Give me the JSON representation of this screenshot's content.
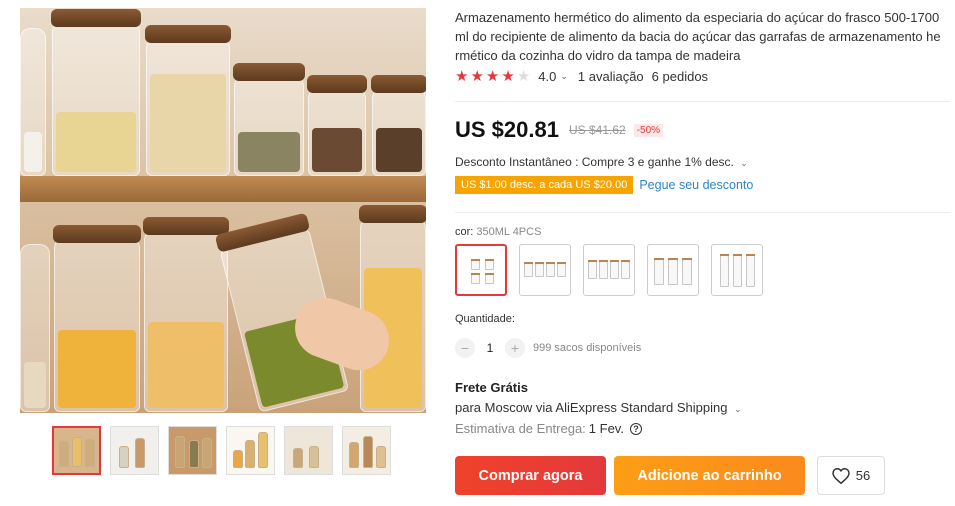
{
  "product": {
    "title": "Armazenamento hermético do alimento da especiaria do açúcar do frasco 500-1700 ml do recipiente de alimento da bacia do açúcar das garrafas de armazenamento he rmético da cozinha do vidro da tampa de madeira",
    "rating": "4.0",
    "stars_filled": 4,
    "stars_total": 5,
    "reviews": "1 avaliação",
    "orders": "6 pedidos"
  },
  "price": {
    "current": "US $20.81",
    "original": "US $41.62",
    "discount": "-50%"
  },
  "promo": {
    "instant": "Desconto Instantâneo : Compre 3 e ganhe 1% desc.",
    "coupon": "US $1.00 desc. a cada US $20.00",
    "coupon_link": "Pegue seu desconto"
  },
  "variant": {
    "label": "cor:",
    "selected": "350ML 4PCS"
  },
  "quantity": {
    "label": "Quantidade:",
    "value": "1",
    "minus": "−",
    "plus": "+",
    "available": "999 sacos disponíveis"
  },
  "shipping": {
    "title": "Frete Grátis",
    "line": "para Moscow via AliExpress Standard Shipping",
    "delivery_label": "Estimativa de Entrega:",
    "delivery_value": "1 Fev."
  },
  "actions": {
    "buy": "Comprar agora",
    "cart": "Adicione ao carrinho",
    "wishlist_count": "56"
  },
  "colors": {
    "accent_red": "#e4393c",
    "accent_orange": "#fb8a1c",
    "coupon_bg": "#f7a400",
    "link": "#2f86c4"
  },
  "icons": {
    "star": "star-icon",
    "heart": "heart-icon",
    "help": "question-circle-icon",
    "chevron": "chevron-down-icon"
  }
}
